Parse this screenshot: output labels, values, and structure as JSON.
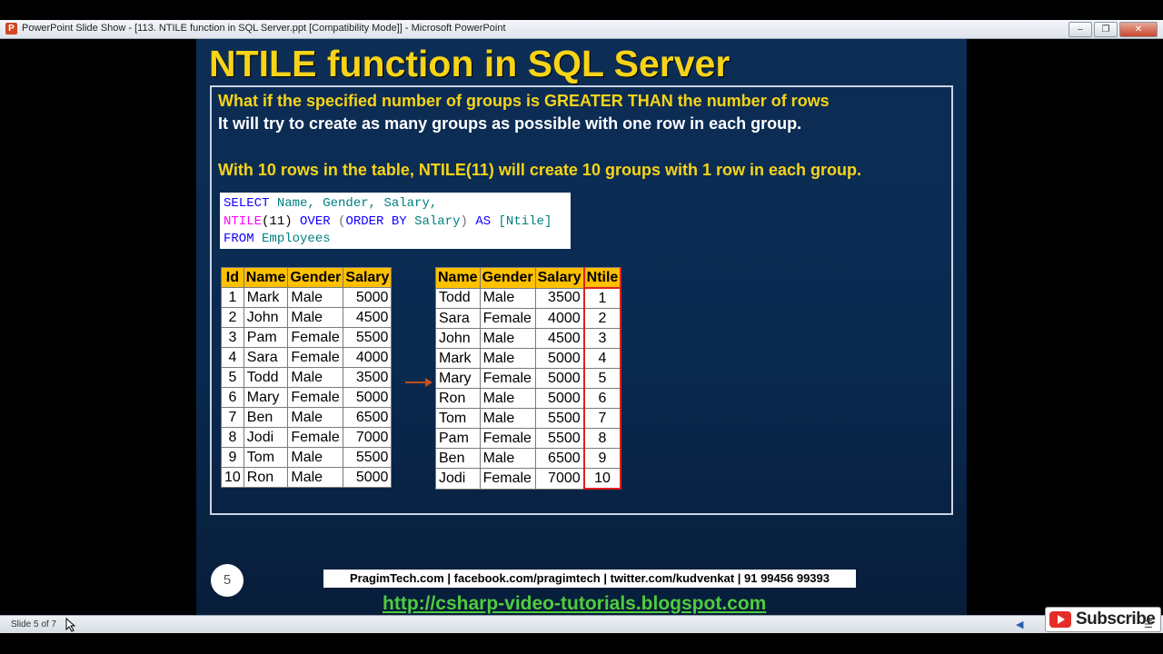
{
  "window": {
    "app_icon": "P",
    "title": "PowerPoint Slide Show - [113. NTILE function in SQL Server.ppt [Compatibility Mode]] - Microsoft PowerPoint",
    "buttons": [
      "minimize-icon",
      "restore-icon",
      "close-icon"
    ]
  },
  "slide": {
    "title": "NTILE function in SQL Server",
    "line1": "What if the specified number of groups is GREATER THAN the number of rows",
    "line2": "It will try to create as many groups as possible with one row in each group.",
    "line3": "With 10 rows in the table, NTILE(11) will create 10 groups with 1 row in each group.",
    "code": {
      "l1_kw": "SELECT",
      "l1_rest": " Name, Gender, Salary,",
      "l2_fn": "NTILE",
      "l2_arg": "(11) ",
      "l2_over": "OVER ",
      "l2_open": "(",
      "l2_order": "ORDER BY ",
      "l2_col": "Salary",
      "l2_close": ") ",
      "l2_as": "AS ",
      "l2_alias": "[Ntile]",
      "l3_kw": "FROM",
      "l3_tbl": " Employees"
    },
    "employees_table": {
      "headers": [
        "Id",
        "Name",
        "Gender",
        "Salary"
      ],
      "rows": [
        [
          "1",
          "Mark",
          "Male",
          "5000"
        ],
        [
          "2",
          "John",
          "Male",
          "4500"
        ],
        [
          "3",
          "Pam",
          "Female",
          "5500"
        ],
        [
          "4",
          "Sara",
          "Female",
          "4000"
        ],
        [
          "5",
          "Todd",
          "Male",
          "3500"
        ],
        [
          "6",
          "Mary",
          "Female",
          "5000"
        ],
        [
          "7",
          "Ben",
          "Male",
          "6500"
        ],
        [
          "8",
          "Jodi",
          "Female",
          "7000"
        ],
        [
          "9",
          "Tom",
          "Male",
          "5500"
        ],
        [
          "10",
          "Ron",
          "Male",
          "5000"
        ]
      ]
    },
    "result_table": {
      "headers": [
        "Name",
        "Gender",
        "Salary",
        "Ntile"
      ],
      "rows": [
        [
          "Todd",
          "Male",
          "3500",
          "1"
        ],
        [
          "Sara",
          "Female",
          "4000",
          "2"
        ],
        [
          "John",
          "Male",
          "4500",
          "3"
        ],
        [
          "Mark",
          "Male",
          "5000",
          "4"
        ],
        [
          "Mary",
          "Female",
          "5000",
          "5"
        ],
        [
          "Ron",
          "Male",
          "5000",
          "6"
        ],
        [
          "Tom",
          "Male",
          "5500",
          "7"
        ],
        [
          "Pam",
          "Female",
          "5500",
          "8"
        ],
        [
          "Ben",
          "Male",
          "6500",
          "9"
        ],
        [
          "Jodi",
          "Female",
          "7000",
          "10"
        ]
      ]
    },
    "slide_number": "5",
    "contact": "PragimTech.com | facebook.com/pragimtech | twitter.com/kudvenkat | 91 99456 99393",
    "blog_url": "http://csharp-video-tutorials.blogspot.com"
  },
  "statusbar": {
    "slide_status": "Slide 5 of 7"
  },
  "overlay": {
    "subscribe_label": "Subscribe"
  },
  "colors": {
    "title_yellow": "#f7d418",
    "slide_bg": "#0a2a50",
    "header_orange": "#ffc000",
    "ntile_box_red": "#e0201e",
    "link_green": "#4fcc3d"
  }
}
